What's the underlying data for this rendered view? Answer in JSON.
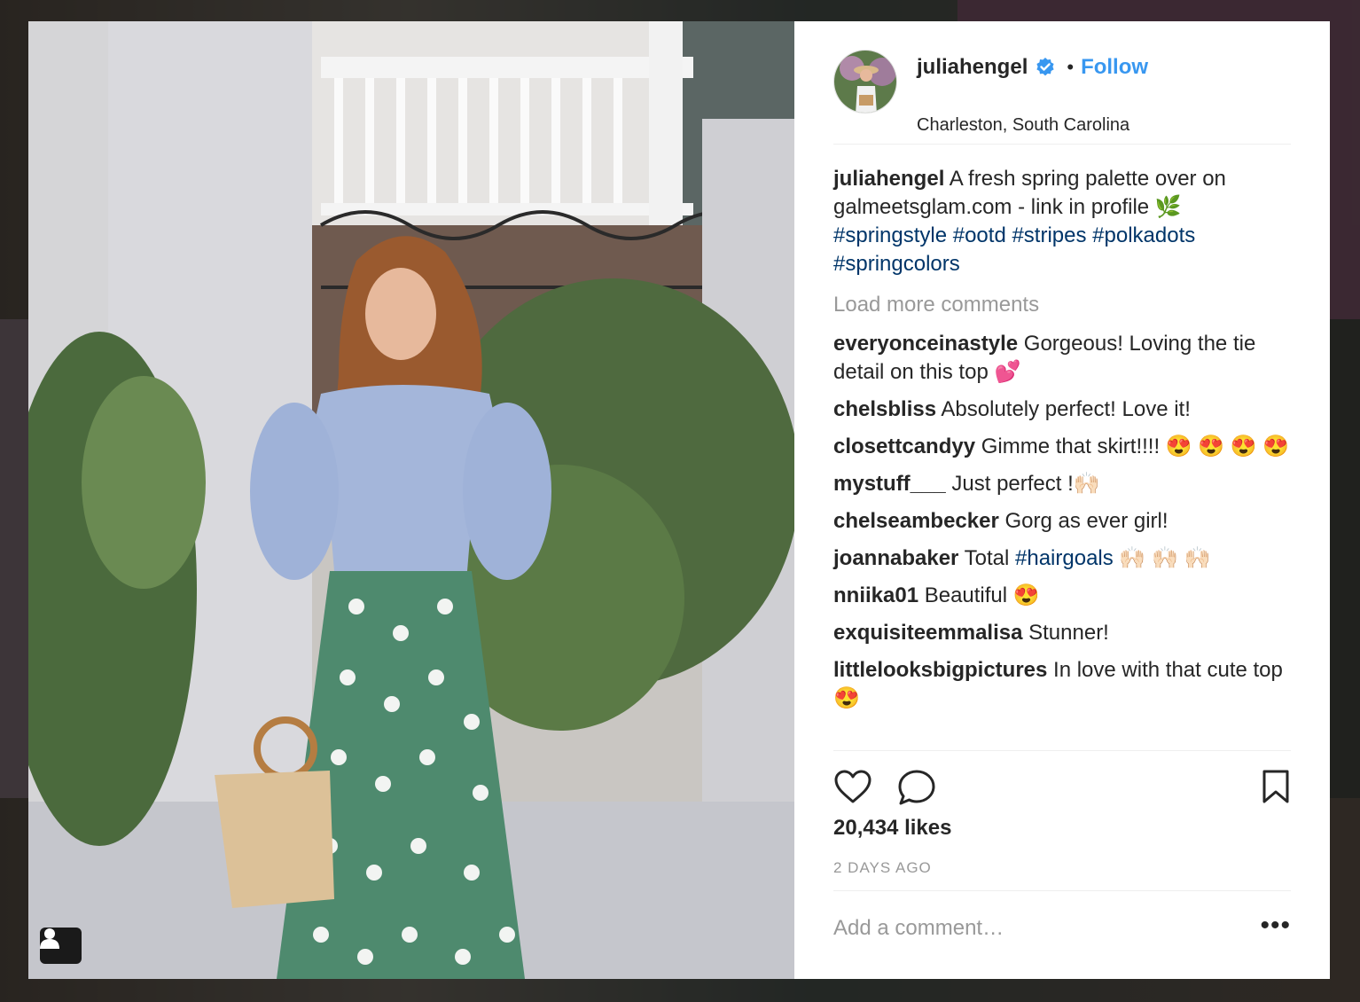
{
  "post": {
    "username": "juliahengel",
    "follow_label": "Follow",
    "dot": "•",
    "location": "Charleston, South Carolina",
    "caption": {
      "user": "juliahengel",
      "text": " A fresh spring palette over on galmeetsglam.com - link in profile 🌿",
      "hashtags": "#springstyle #ootd #stripes #polkadots #springcolors"
    },
    "load_more": "Load more comments",
    "comments": [
      {
        "user": "everyonceinastyle",
        "text": " Gorgeous! Loving the tie detail on this top 💕"
      },
      {
        "user": "chelsbliss",
        "text": " Absolutely perfect! Love it!"
      },
      {
        "user": "closettcandyy",
        "text": " Gimme that skirt!!!! 😍 😍 😍 😍"
      },
      {
        "user": "mystuff___",
        "text": " Just perfect !🙌🏻"
      },
      {
        "user": "chelseambecker",
        "text": " Gorg as ever girl!"
      },
      {
        "user": "joannabaker",
        "text": " Total ",
        "tag": "#hairgoals",
        "after": " 🙌🏻 🙌🏻 🙌🏻"
      },
      {
        "user": "nniika01",
        "text": " Beautiful 😍"
      },
      {
        "user": "exquisiteemmalisa",
        "text": " Stunner!"
      },
      {
        "user": "littlelooksbigpictures",
        "text": " In love with that cute top 😍"
      }
    ],
    "likes": "20,434 likes",
    "time": "2 DAYS AGO",
    "add_comment_placeholder": "Add a comment…",
    "more_label": "•••"
  },
  "icons": {
    "like": "heart-icon",
    "comment": "comment-bubble-icon",
    "save": "bookmark-icon",
    "tag": "user-tag-icon",
    "verified": "verified-badge-icon"
  },
  "colors": {
    "link_blue": "#3897f0",
    "hashtag": "#003569",
    "muted": "#999999"
  }
}
